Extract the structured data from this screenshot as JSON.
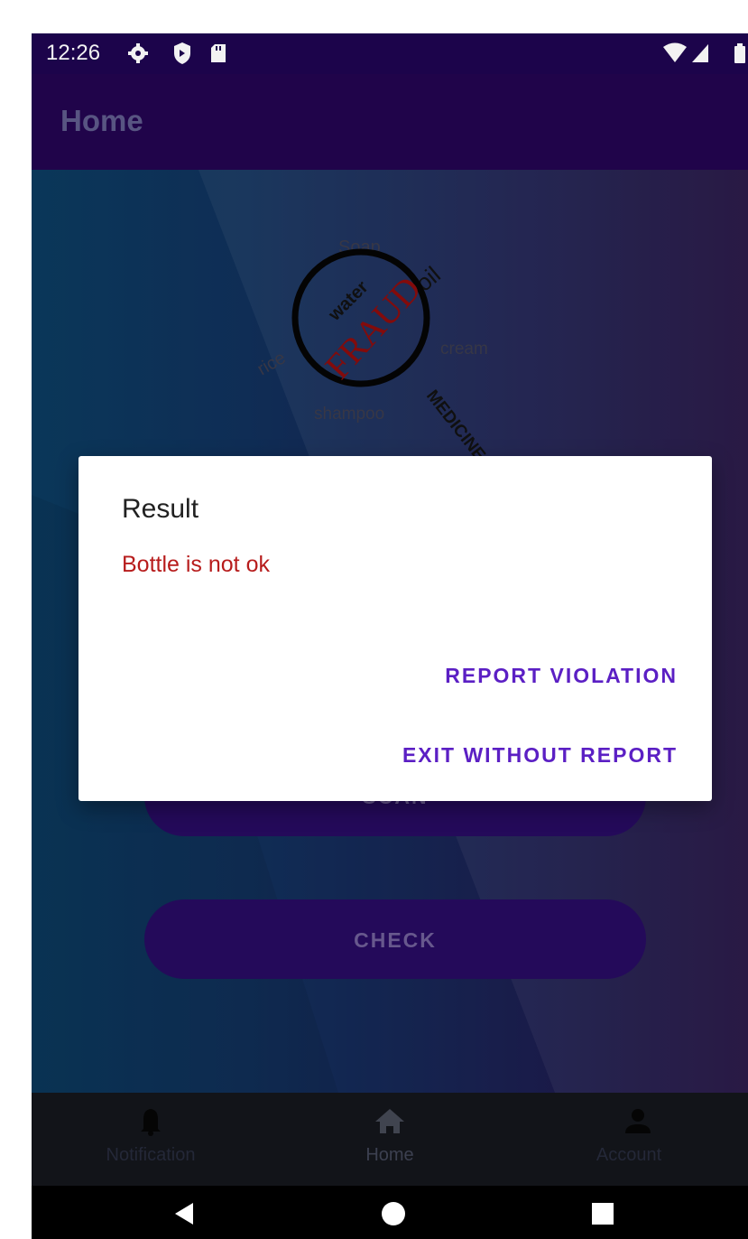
{
  "status_bar": {
    "time": "12:26",
    "icons": [
      "gear-icon",
      "shield-icon",
      "sd-card-icon",
      "wifi-icon",
      "signal-icon",
      "battery-icon"
    ]
  },
  "app_bar": {
    "title": "Home"
  },
  "logo": {
    "words": {
      "soap": "Soap",
      "oil": "oil",
      "water": "water",
      "fraud": "FRAUD",
      "rice": "rice",
      "cream": "cream",
      "shampoo": "shampoo",
      "medicines": "MEDICINES"
    }
  },
  "main": {
    "scan_button": {
      "label": "SCAN"
    },
    "check_button": {
      "label": "CHECK"
    }
  },
  "dialog": {
    "title": "Result",
    "message": "Bottle is not ok",
    "report_button": "REPORT VIOLATION",
    "exit_button": "EXIT WITHOUT REPORT"
  },
  "bottom_nav": {
    "items": [
      {
        "label": "Notification",
        "icon": "bell-icon"
      },
      {
        "label": "Home",
        "icon": "home-icon"
      },
      {
        "label": "Account",
        "icon": "person-icon"
      }
    ]
  },
  "colors": {
    "status_bar": "#1e0550",
    "app_bar": "#22054f",
    "accent": "#5b1fc4",
    "error_text": "#b71c1c",
    "button": "#260b5f"
  }
}
